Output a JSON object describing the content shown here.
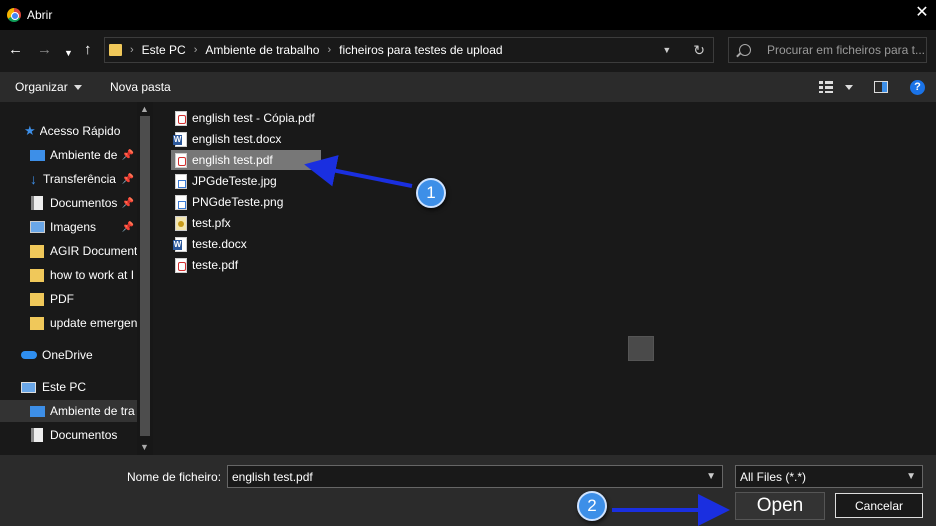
{
  "window": {
    "title": "Abrir"
  },
  "address": {
    "crumbs": [
      "Este PC",
      "Ambiente de trabalho",
      "ficheiros para testes de upload"
    ]
  },
  "search": {
    "placeholder": "Procurar em ficheiros para t..."
  },
  "toolbar": {
    "organize_label": "Organizar",
    "new_folder_label": "Nova pasta",
    "help_label": "?"
  },
  "sidebar": {
    "items": [
      {
        "label": "Acesso Rápido",
        "icon": "star-icon",
        "pinned": false
      },
      {
        "label": "Ambiente de",
        "icon": "desktop-icon",
        "pinned": true
      },
      {
        "label": "Transferência",
        "icon": "download-icon",
        "pinned": true
      },
      {
        "label": "Documentos",
        "icon": "document-icon",
        "pinned": true
      },
      {
        "label": "Imagens",
        "icon": "pictures-icon",
        "pinned": true
      },
      {
        "label": "AGIR Document",
        "icon": "folder-icon",
        "pinned": false
      },
      {
        "label": "how to work at I",
        "icon": "folder-icon",
        "pinned": false
      },
      {
        "label": "PDF",
        "icon": "folder-icon",
        "pinned": false
      },
      {
        "label": "update emergen",
        "icon": "folder-icon",
        "pinned": false
      },
      {
        "label": "OneDrive",
        "icon": "cloud-icon",
        "pinned": false
      },
      {
        "label": "Este PC",
        "icon": "computer-icon",
        "pinned": false
      },
      {
        "label": "Ambiente de tra",
        "icon": "desktop-icon",
        "pinned": false
      },
      {
        "label": "Documentos",
        "icon": "document-icon",
        "pinned": false
      }
    ]
  },
  "files": [
    {
      "name": "english test - Cópia.pdf",
      "type": "pdf"
    },
    {
      "name": "english test.docx",
      "type": "docx"
    },
    {
      "name": "english test.pdf",
      "type": "pdf",
      "selected": true
    },
    {
      "name": "JPGdeTeste.jpg",
      "type": "jpg"
    },
    {
      "name": "PNGdeTeste.png",
      "type": "png"
    },
    {
      "name": "test.pfx",
      "type": "pfx"
    },
    {
      "name": "teste.docx",
      "type": "docx"
    },
    {
      "name": "teste.pdf",
      "type": "pdf"
    }
  ],
  "bottom": {
    "filename_label": "Nome de ficheiro:",
    "filename_value": "english test.pdf",
    "filter_value": "All Files (*.*)",
    "open_label": "Open",
    "cancel_label": "Cancelar"
  },
  "annotations": {
    "badge1": "1",
    "badge2": "2",
    "arrow_color": "#1a2fe0"
  },
  "colors": {
    "accent": "#3d8fe8",
    "selection": "#777777"
  }
}
